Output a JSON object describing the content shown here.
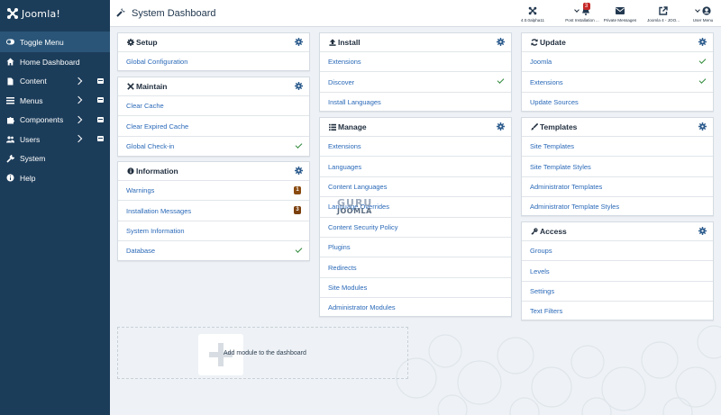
{
  "app": {
    "logo_text": "Joomla!"
  },
  "header": {
    "title": "System Dashboard",
    "buttons": [
      {
        "label": "4.0.0alpha11",
        "icon": "joomla-icon"
      },
      {
        "label": "Post Installation ...",
        "icon": "bell-icon",
        "badge": "3"
      },
      {
        "label": "Private Messages",
        "icon": "envelope-icon"
      },
      {
        "label": "Joomla 4 - JOO...",
        "icon": "external-link-icon"
      },
      {
        "label": "User Menu",
        "icon": "user-icon"
      }
    ]
  },
  "sidebar": {
    "items": [
      {
        "label": "Toggle Menu",
        "icon": "toggle-icon"
      },
      {
        "label": "Home Dashboard",
        "icon": "home-icon"
      },
      {
        "label": "Content",
        "icon": "file-icon"
      },
      {
        "label": "Menus",
        "icon": "list-icon"
      },
      {
        "label": "Components",
        "icon": "puzzle-icon"
      },
      {
        "label": "Users",
        "icon": "users-icon"
      },
      {
        "label": "System",
        "icon": "wrench-icon"
      },
      {
        "label": "Help",
        "icon": "info-icon"
      }
    ]
  },
  "cards": {
    "setup": {
      "title": "Setup",
      "items": [
        "Global Configuration"
      ]
    },
    "maintain": {
      "title": "Maintain",
      "items": [
        "Clear Cache",
        "Clear Expired Cache",
        "Global Check-in"
      ]
    },
    "information": {
      "title": "Information",
      "items": [
        "Warnings",
        "Installation Messages",
        "System Information",
        "Database"
      ],
      "badges": {
        "warnings": "1",
        "installation": "3"
      }
    },
    "install": {
      "title": "Install",
      "items": [
        "Extensions",
        "Discover",
        "Install Languages"
      ]
    },
    "manage": {
      "title": "Manage",
      "items": [
        "Extensions",
        "Languages",
        "Content Languages",
        "Language Overrides",
        "Content Security Policy",
        "Plugins",
        "Redirects",
        "Site Modules",
        "Administrator Modules"
      ]
    },
    "update": {
      "title": "Update",
      "items": [
        "Joomla",
        "Extensions",
        "Update Sources"
      ]
    },
    "templates": {
      "title": "Templates",
      "items": [
        "Site Templates",
        "Site Template Styles",
        "Administrator Templates",
        "Administrator Template Styles"
      ]
    },
    "access": {
      "title": "Access",
      "items": [
        "Groups",
        "Levels",
        "Settings",
        "Text Filters"
      ]
    }
  },
  "add_module": {
    "label": "Add module to the dashboard"
  },
  "watermark": {
    "line1": "GURU",
    "line2": "JOOMLA"
  },
  "colors": {
    "sidebar_bg": "#1c3d5a",
    "toggle_bg": "#2a5578",
    "link": "#2a69b8",
    "check": "#2f8a3a",
    "badge_warning": "#8a4b10",
    "badge_install": "#7a3f0c",
    "notification": "#c52827"
  }
}
